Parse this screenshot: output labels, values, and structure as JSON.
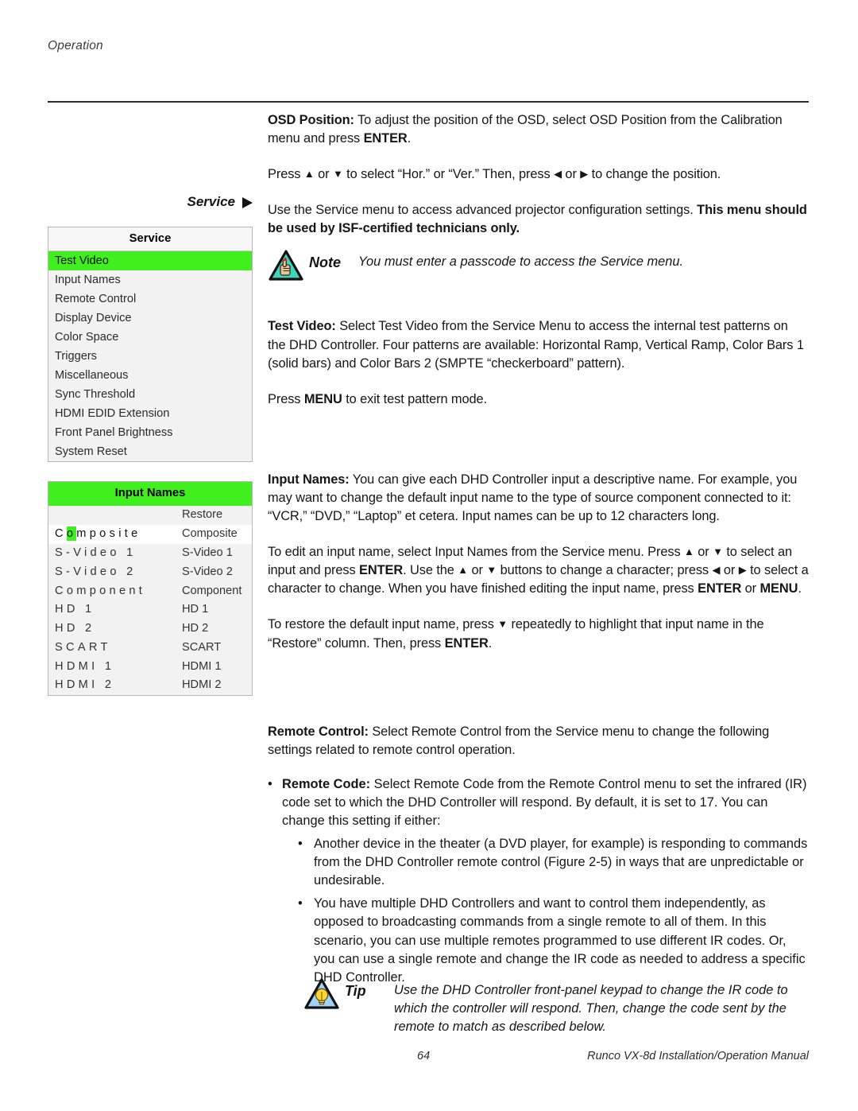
{
  "header": {
    "running_head": "Operation"
  },
  "side_label": {
    "text": "Service"
  },
  "intro": {
    "osd_position_label": "OSD Position:",
    "osd_position_text": " To adjust the position of the OSD, select OSD Position from the Calibration menu and press ",
    "osd_position_enter": "ENTER",
    "osd_position_end": ".",
    "press_line_a": "Press ",
    "press_line_b": " or ",
    "press_line_c": " to select “Hor.” or “Ver.” Then, press ",
    "press_line_d": " or ",
    "press_line_e": " to change the position.",
    "service_text": "Use the Service menu to access advanced projector configuration settings. ",
    "service_bold": "This menu should be used by ISF-certified technicians only."
  },
  "note": {
    "icon": "note-hand-triangle-icon",
    "word": "Note",
    "body": "You must enter a passcode to access the Service menu."
  },
  "tip": {
    "icon": "tip-lightbulb-triangle-icon",
    "word": "Tip",
    "body": "Use the DHD Controller front-panel keypad to change the IR code to which the controller will respond. Then, change the code sent by the remote to match as described below."
  },
  "service_menu": {
    "title": "Service",
    "selected": "Test Video",
    "items": [
      "Test Video",
      "Input Names",
      "Remote Control",
      "Display Device",
      "Color Space",
      "Triggers",
      "Miscellaneous",
      "Sync Threshold",
      "HDMI EDID Extension",
      "Front Panel Brightness",
      "System Reset"
    ]
  },
  "input_names_menu": {
    "title": "Input Names",
    "restore_header": "Restore",
    "editing_row_index": 0,
    "cursor_char_index": 1,
    "rows": [
      {
        "name": "Composite",
        "restore": "Composite"
      },
      {
        "name": "S-Video 1",
        "restore": "S-Video 1"
      },
      {
        "name": "S-Video 2",
        "restore": "S-Video 2"
      },
      {
        "name": "Component",
        "restore": "Component"
      },
      {
        "name": "HD 1",
        "restore": "HD 1"
      },
      {
        "name": "HD 2",
        "restore": "HD 2"
      },
      {
        "name": "SCART",
        "restore": "SCART"
      },
      {
        "name": "HDMI 1",
        "restore": "HDMI 1"
      },
      {
        "name": "HDMI 2",
        "restore": "HDMI 2"
      }
    ]
  },
  "test_video": {
    "label": "Test Video:",
    "body": " Select Test Video from the Service Menu to access the internal test patterns on the DHD Controller. Four patterns are available: Horizontal Ramp, Vertical Ramp, Color Bars 1 (solid bars) and Color Bars 2 (SMPTE “checkerboard” pattern).",
    "exit_a": "Press ",
    "exit_menu": "MENU",
    "exit_b": " to exit test pattern mode."
  },
  "input_names_text": {
    "label": "Input Names:",
    "body": " You can give each DHD Controller input a descriptive name. For example, you may want to change the default input name to the type of source component connected to it: “VCR,” “DVD,” “Laptop” et cetera. Input names can be up to 12 characters long.",
    "edit_a": "To edit an input name, select Input Names from the Service menu. Press ",
    "edit_b": " or ",
    "edit_c": " to select an input and press ",
    "edit_enter": "ENTER",
    "edit_d": ". Use the ",
    "edit_e": " or ",
    "edit_f": " buttons to change a character; press ",
    "edit_g": " or ",
    "edit_h": " to select a character to change. When you have finished editing the input name, press ",
    "edit_enter2": "ENTER",
    "edit_i": " or ",
    "edit_menu2": "MENU",
    "edit_j": ".",
    "restore_a": "To restore the default input name, press ",
    "restore_b": " repeatedly to highlight that input name in the “Restore” column. Then, press ",
    "restore_enter": "ENTER",
    "restore_c": "."
  },
  "remote_control": {
    "label": "Remote Control:",
    "body": " Select Remote Control from the Service menu to change the following settings related to remote control operation.",
    "bullet_label": "Remote Code:",
    "bullet_body": " Select Remote Code from the Remote Control menu to set the infrared (IR) code set to which the DHD Controller will respond. By default, it is set to 17. You can change this setting if either:",
    "sub_bullet_1": "Another device in the theater (a DVD player, for example) is responding to commands from the DHD Controller remote control (Figure 2-5) in ways that are unpredictable or undesirable.",
    "sub_bullet_2": "You have multiple DHD Controllers and want to control them independently, as opposed to broadcasting commands from a single remote to all of them. In this scenario, you can use multiple remotes programmed to use different IR codes. Or, you can use a single remote and change the IR code as needed to address a specific DHD Controller.",
    "bullet_glyph": "•"
  },
  "footer": {
    "page_number": "64",
    "manual_title": "Runco VX-8d Installation/Operation Manual"
  },
  "colors": {
    "osd_green": "#41ee1e",
    "panel_bg": "#f2f2f2",
    "panel_border": "#b7b7b7",
    "note_triangle": "#3ed6bd",
    "tip_triangle": "#9fd2f5",
    "tip_bulb": "#ffd433"
  },
  "glyphs": {
    "up": "▲",
    "down": "▼",
    "left": "◀",
    "right": "▶"
  }
}
